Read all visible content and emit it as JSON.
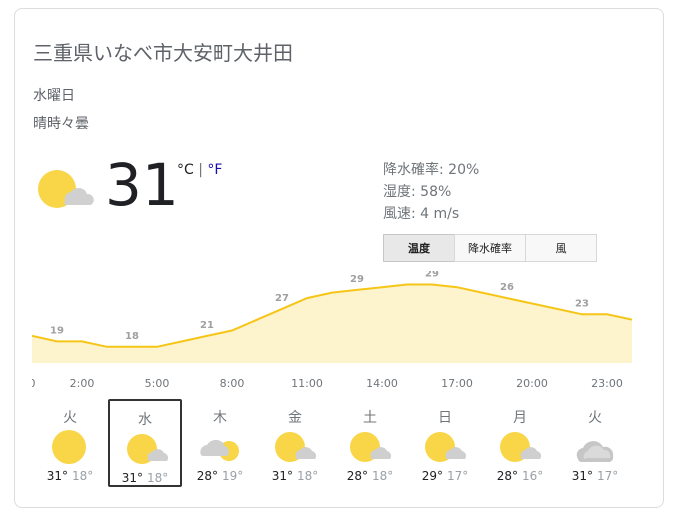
{
  "location": "三重県いなべ市大安町大井田",
  "day": "水曜日",
  "condition": "晴時々曇",
  "current": {
    "icon": "sun-cloud-icon",
    "temp": "31",
    "unit_c": "°C",
    "unit_sep": " | ",
    "unit_f": "°F"
  },
  "details": {
    "precip": "降水確率: 20%",
    "humidity": "湿度: 58%",
    "wind": "風速: 4 m/s"
  },
  "tabs": [
    {
      "label": "温度",
      "active": true
    },
    {
      "label": "降水確率",
      "active": false
    },
    {
      "label": "風",
      "active": false
    }
  ],
  "colors": {
    "line": "#f5c518",
    "fill": "#fdf3cc",
    "label": "#a0a0a0"
  },
  "chart_data": {
    "type": "area",
    "x": [
      "0:00",
      "1:00",
      "2:00",
      "3:00",
      "4:00",
      "5:00",
      "6:00",
      "7:00",
      "8:00",
      "9:00",
      "10:00",
      "11:00",
      "12:00",
      "13:00",
      "14:00",
      "15:00",
      "16:00",
      "17:00",
      "18:00",
      "19:00",
      "20:00",
      "21:00",
      "22:00",
      "23:00",
      "24:00"
    ],
    "values": [
      20,
      19,
      19,
      18,
      18,
      18,
      19,
      20,
      21,
      23,
      25,
      27,
      28,
      28.5,
      29,
      29.5,
      29.5,
      29,
      28,
      27,
      26,
      25,
      24,
      24,
      23
    ],
    "labeled": [
      {
        "index": 1,
        "label": "19"
      },
      {
        "index": 4,
        "label": "18"
      },
      {
        "index": 7,
        "label": "21"
      },
      {
        "index": 10,
        "label": "27"
      },
      {
        "index": 13,
        "label": "29"
      },
      {
        "index": 16,
        "label": "29"
      },
      {
        "index": 19,
        "label": "26"
      },
      {
        "index": 22,
        "label": "23"
      }
    ],
    "tick_labels": [
      "0",
      "2:00",
      "5:00",
      "8:00",
      "11:00",
      "14:00",
      "17:00",
      "20:00",
      "23:00"
    ],
    "tick_indices": [
      0,
      2,
      5,
      8,
      11,
      14,
      17,
      20,
      23
    ],
    "ylim": [
      15,
      32
    ]
  },
  "days": [
    {
      "name": "火",
      "icon": "sun-icon",
      "hi": "31°",
      "lo": "18°",
      "selected": false
    },
    {
      "name": "水",
      "icon": "sun-cloud-icon",
      "hi": "31°",
      "lo": "18°",
      "selected": true
    },
    {
      "name": "木",
      "icon": "cloud-sun-icon",
      "hi": "28°",
      "lo": "19°",
      "selected": false
    },
    {
      "name": "金",
      "icon": "sun-cloud-icon",
      "hi": "31°",
      "lo": "18°",
      "selected": false
    },
    {
      "name": "土",
      "icon": "sun-cloud-icon",
      "hi": "28°",
      "lo": "18°",
      "selected": false
    },
    {
      "name": "日",
      "icon": "sun-cloud-icon",
      "hi": "29°",
      "lo": "17°",
      "selected": false
    },
    {
      "name": "月",
      "icon": "sun-cloud-icon",
      "hi": "28°",
      "lo": "16°",
      "selected": false
    },
    {
      "name": "火",
      "icon": "cloud-icon",
      "hi": "31°",
      "lo": "17°",
      "selected": false
    }
  ]
}
